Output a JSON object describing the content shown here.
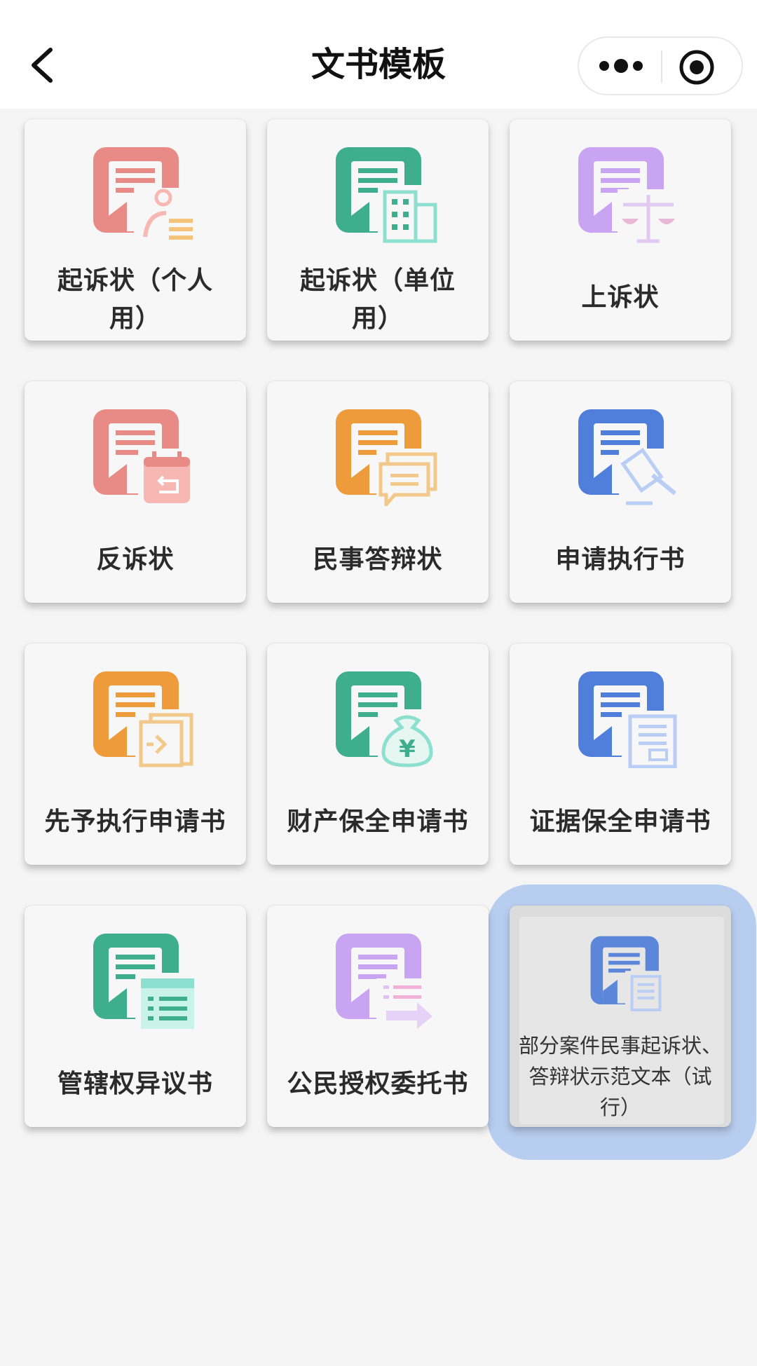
{
  "header": {
    "title": "文书模板"
  },
  "tiles": [
    {
      "label": "起诉状（个人用）",
      "color": "#e88b86",
      "accent": "#f5c47a"
    },
    {
      "label": "起诉状（单位用）",
      "color": "#3fae8c",
      "accent": "#8de0d0"
    },
    {
      "label": "上诉状",
      "color": "#c9a4f2",
      "accent": "#e8b8d6"
    },
    {
      "label": "反诉状",
      "color": "#e88b86",
      "accent": "#f7b7b3"
    },
    {
      "label": "民事答辩状",
      "color": "#ee9b3c",
      "accent": "#f2c98a"
    },
    {
      "label": "申请执行书",
      "color": "#4f7fdb",
      "accent": "#b9cdf5"
    },
    {
      "label": "先予执行申请书",
      "color": "#ee9b3c",
      "accent": "#f2c98a"
    },
    {
      "label": "财产保全申请书",
      "color": "#3fae8c",
      "accent": "#8de0d0"
    },
    {
      "label": "证据保全申请书",
      "color": "#4f7fdb",
      "accent": "#b9cdf5"
    },
    {
      "label": "管辖权异议书",
      "color": "#3fae8c",
      "accent": "#8de0d0"
    },
    {
      "label": "公民授权委托书",
      "color": "#c9a4f2",
      "accent": "#f0b0d8"
    },
    {
      "label": "部分案件民事起诉状、答辩状示范文本（试行）",
      "color": "#5b86d9",
      "accent": "#b9cdf5"
    }
  ]
}
